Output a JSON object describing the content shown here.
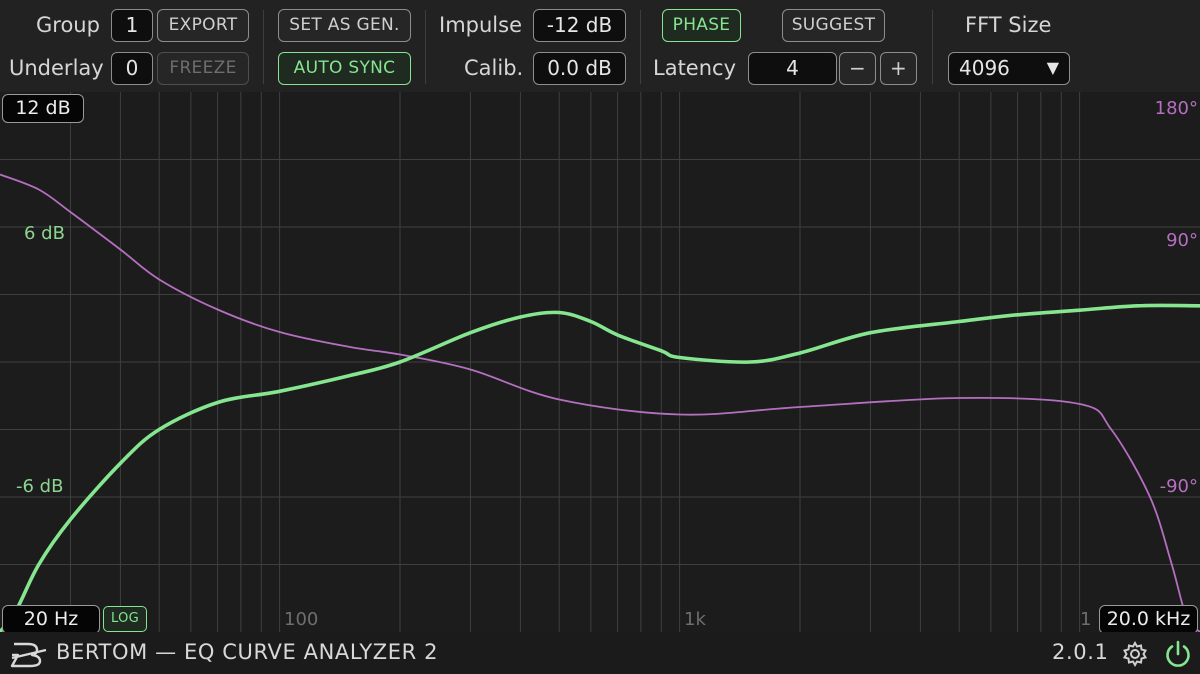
{
  "toolbar": {
    "group_label": "Group",
    "group_value": "1",
    "underlay_label": "Underlay",
    "underlay_value": "0",
    "export_label": "EXPORT",
    "freeze_label": "FREEZE",
    "set_as_gen_label": "SET AS GEN.",
    "auto_sync_label": "AUTO SYNC",
    "impulse_label": "Impulse",
    "impulse_value": "-12 dB",
    "calib_label": "Calib.",
    "calib_value": "0.0 dB",
    "phase_label": "PHASE",
    "suggest_label": "SUGGEST",
    "latency_label": "Latency",
    "latency_value": "4",
    "latency_minus": "−",
    "latency_plus": "+",
    "fft_label": "FFT Size",
    "fft_value": "4096"
  },
  "plot": {
    "range_top": "12 dB",
    "freq_min": "20 Hz",
    "freq_max": "20.0 kHz",
    "log_label": "LOG",
    "db_labels": [
      "6 dB",
      "-6 dB"
    ],
    "phase_labels": [
      "180°",
      "90°",
      "-90°"
    ],
    "freq_labels": [
      "100",
      "1k",
      "1"
    ]
  },
  "colors": {
    "magnitude": "#86e58f",
    "phase": "#b56fc0",
    "grid": "#3f3f3f"
  },
  "chart_data": {
    "type": "line",
    "x_scale": "log",
    "xlim": [
      20,
      20000
    ],
    "ylim": [
      -12,
      12
    ],
    "phase_ylim": [
      -180,
      180
    ],
    "series": [
      {
        "name": "",
        "axis": "db",
        "x": [
          20,
          22,
          25,
          30,
          40,
          50,
          70,
          100,
          150,
          200,
          300,
          400,
          500,
          600,
          700,
          900,
          1000,
          1500,
          2000,
          3000,
          5000,
          7000,
          10000,
          14000,
          20000
        ],
        "y": [
          -12,
          -11,
          -9,
          -7,
          -4.5,
          -3,
          -1.8,
          -1.3,
          -0.6,
          0,
          1.3,
          2,
          2.2,
          1.8,
          1.2,
          0.5,
          0.2,
          0,
          0.4,
          1.3,
          1.8,
          2.1,
          2.3,
          2.5,
          2.5
        ]
      },
      {
        "name": "",
        "axis": "phase",
        "x": [
          20,
          25,
          30,
          40,
          50,
          70,
          100,
          150,
          200,
          300,
          500,
          1000,
          2000,
          5000,
          10000,
          12000,
          15000,
          17000,
          18500,
          20000
        ],
        "y": [
          125,
          115,
          100,
          75,
          55,
          35,
          20,
          10,
          5,
          -5,
          -25,
          -35,
          -30,
          -24,
          -28,
          -45,
          -90,
          -135,
          -170,
          -180
        ]
      }
    ]
  }
}
